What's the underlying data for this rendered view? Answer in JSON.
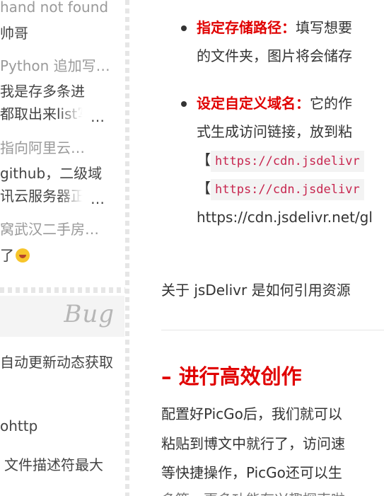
{
  "sidebar": {
    "comments": [
      {
        "meta": "hand not found",
        "text": "帅哥",
        "text_suffix": ""
      },
      {
        "meta": "Python 追加写…",
        "line1": "我是存多条进",
        "line2": "都取出来list写",
        "line2_ellipsis": "…"
      },
      {
        "meta": "指向阿里云…",
        "line1": "github，二级域",
        "line2": "讯云服务器正",
        "line2_ellipsis": "…"
      },
      {
        "meta": "窝武汉二手房…",
        "text": "了",
        "emoji": "laughing-crying-emoji"
      }
    ],
    "card_label": "Bug",
    "links": [
      "自动更新动态获取",
      "ohttp",
      "文件描述符最大"
    ]
  },
  "article": {
    "bullet1": {
      "label": "指定存储路径：",
      "text": "填写想要",
      "line2": "的文件夹，图片将会储存"
    },
    "bullet2": {
      "label": "设定自定义域名：",
      "text": "它的作",
      "line2": "式生成访问链接，放到粘",
      "code1_bracket": "【",
      "code1": "https://cdn.jsdelivr",
      "code2_bracket": "【",
      "code2": "https://cdn.jsdelivr",
      "url_line": "https://cdn.jsdelivr.net/gl"
    },
    "paragraph": "关于 jsDelivr 是如何引用资源",
    "section_heading": "– 进行高效创作",
    "body": [
      "配置好PicGo后，我们就可以",
      "粘贴到博文中就行了，访问速",
      "等快捷操作，PicGo还可以生",
      "多等，更多功能有兴趣探索啦"
    ]
  },
  "colors": {
    "accent_red": "#e00000",
    "code_text": "#c7254e",
    "code_bg": "#f3f3f3",
    "muted": "#9a9a9a"
  }
}
